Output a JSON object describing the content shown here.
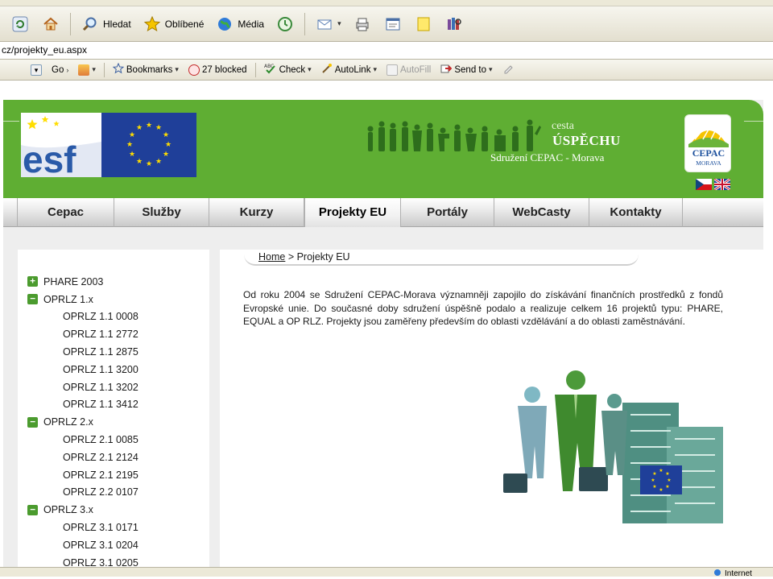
{
  "browser": {
    "toolbar": {
      "search_label": "Hledat",
      "favorites_label": "Oblíbené",
      "media_label": "Média"
    },
    "address": {
      "url": "cz/projekty_eu.aspx"
    },
    "links_bar": {
      "go_label": "Go",
      "bookmarks_label": "Bookmarks",
      "blocked_label": "27 blocked",
      "check_label": "Check",
      "autolink_label": "AutoLink",
      "autofill_label": "AutoFill",
      "send_to_label": "Send to"
    },
    "status": {
      "zone_label": "Internet"
    }
  },
  "site": {
    "header": {
      "tagline_small": "cesta",
      "tagline_big": "ÚSPĚCHU",
      "organization": "Sdružení CEPAC - Morava",
      "logo_text": "CEPAC",
      "logo_subtext": "MORAVA",
      "esf_text": "esf"
    },
    "nav": {
      "items": [
        {
          "label": "Cepac"
        },
        {
          "label": "Služby"
        },
        {
          "label": "Kurzy"
        },
        {
          "label": "Projekty EU"
        },
        {
          "label": "Portály"
        },
        {
          "label": "WebCasty"
        },
        {
          "label": "Kontakty"
        }
      ]
    },
    "sidebar": {
      "tree": [
        {
          "label": "PHARE 2003",
          "expanded": false,
          "children": []
        },
        {
          "label": "OPRLZ 1.x",
          "expanded": true,
          "children": [
            "OPRLZ 1.1 0008",
            "OPRLZ 1.1 2772",
            "OPRLZ 1.1 2875",
            "OPRLZ 1.1 3200",
            "OPRLZ 1.1 3202",
            "OPRLZ 1.1 3412"
          ]
        },
        {
          "label": "OPRLZ 2.x",
          "expanded": true,
          "children": [
            "OPRLZ 2.1 0085",
            "OPRLZ 2.1 2124",
            "OPRLZ 2.1 2195",
            "OPRLZ 2.2 0107"
          ]
        },
        {
          "label": "OPRLZ 3.x",
          "expanded": true,
          "children": [
            "OPRLZ 3.1 0171",
            "OPRLZ 3.1 0204",
            "OPRLZ 3.1 0205"
          ]
        }
      ]
    },
    "main": {
      "breadcrumb_home": "Home",
      "breadcrumb_sep": " > ",
      "breadcrumb_current": "Projekty EU",
      "intro": "Od roku 2004 se Sdružení CEPAC-Morava významněji zapojilo do získávání finančních prostředků z fondů Evropské unie. Do současné doby sdružení úspěšně podalo a realizuje celkem 16 projektů typu: PHARE, EQUAL a OP RLZ. Projekty jsou zaměřeny především do oblasti vzdělávání a do oblasti zaměstnávání."
    }
  },
  "colors": {
    "banner_green": "#5fae33",
    "toggle_green": "#4b9b2e",
    "eu_blue": "#1f3f99",
    "eu_star": "#ffdd00"
  }
}
